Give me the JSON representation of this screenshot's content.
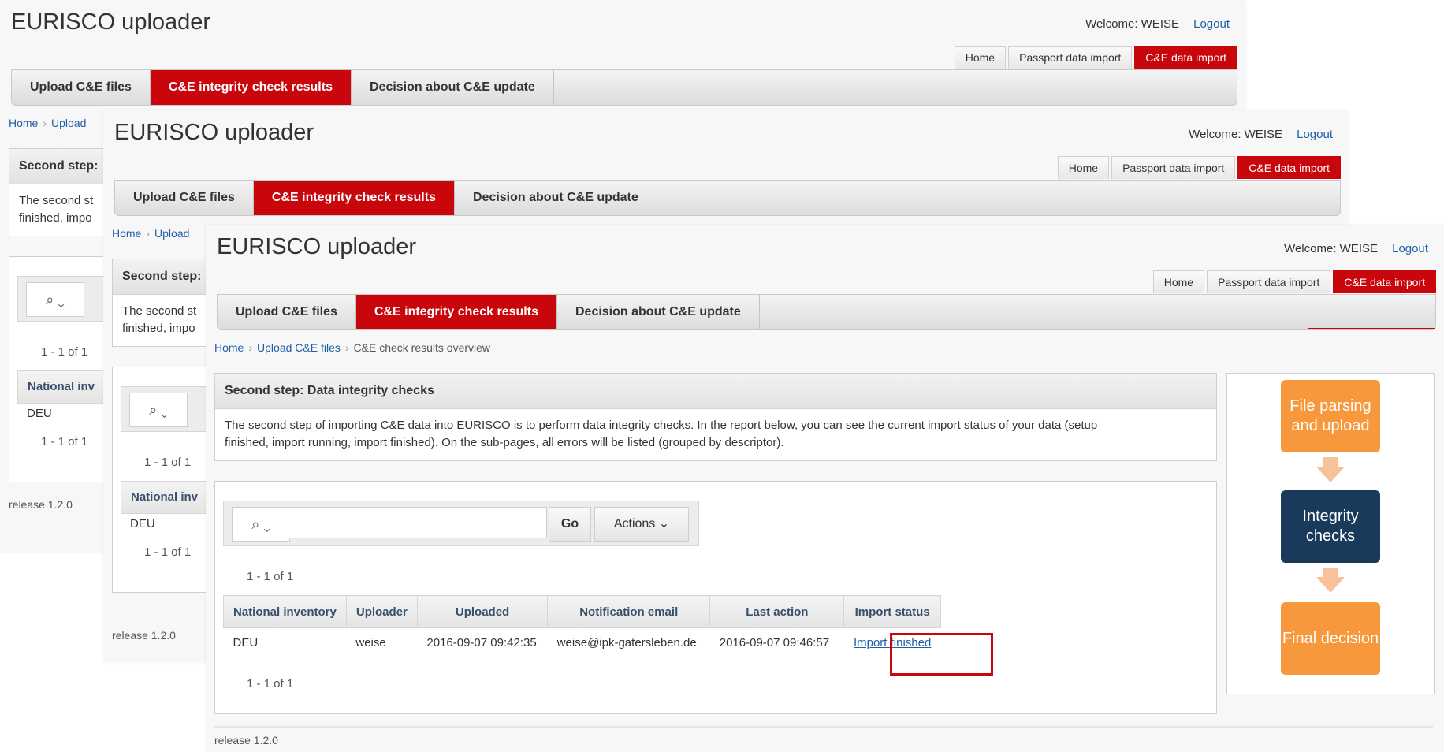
{
  "app": {
    "title": "EURISCO uploader",
    "welcome": "Welcome: WEISE",
    "logout": "Logout",
    "release": "release 1.2.0"
  },
  "top_tabs": [
    "Home",
    "Passport data import",
    "C&E data import"
  ],
  "main_tabs": [
    "Upload C&E files",
    "C&E integrity check results",
    "Decision about C&E update"
  ],
  "breadcrumb": {
    "home": "Home",
    "upload": "Upload C&E files",
    "current": "C&E check results overview",
    "upload_short": "Upload"
  },
  "step": {
    "title": "Second step: Data integrity checks",
    "title_short": "Second step:",
    "line1": "The second step of importing C&E data into EURISCO is to perform data integrity checks. In the report below, you can see the current import status of your data (setup",
    "line2": "finished, import running, import finished). On the sub-pages, all errors will be listed (grouped by descriptor).",
    "line1_short": "The second st",
    "line2_short": "finished, impo"
  },
  "report": {
    "search_value": "",
    "go": "Go",
    "actions": "Actions",
    "pagination": "1 - 1 of 1",
    "columns": [
      "National inventory",
      "Uploader",
      "Uploaded",
      "Notification email",
      "Last action",
      "Import status"
    ],
    "col_short": "National inv",
    "rows": [
      {
        "national_inventory": "DEU",
        "uploader": "weise",
        "uploaded": "2016-09-07 09:42:35",
        "email": "weise@ipk-gatersleben.de",
        "last_action": "2016-09-07 09:46:57",
        "status": "Import finished"
      }
    ]
  },
  "flow": [
    "File parsing and upload",
    "Integrity checks",
    "Final decision"
  ],
  "colors": {
    "accent": "#c8060b",
    "flow_orange": "#f7983c",
    "flow_navy": "#193a5b"
  }
}
